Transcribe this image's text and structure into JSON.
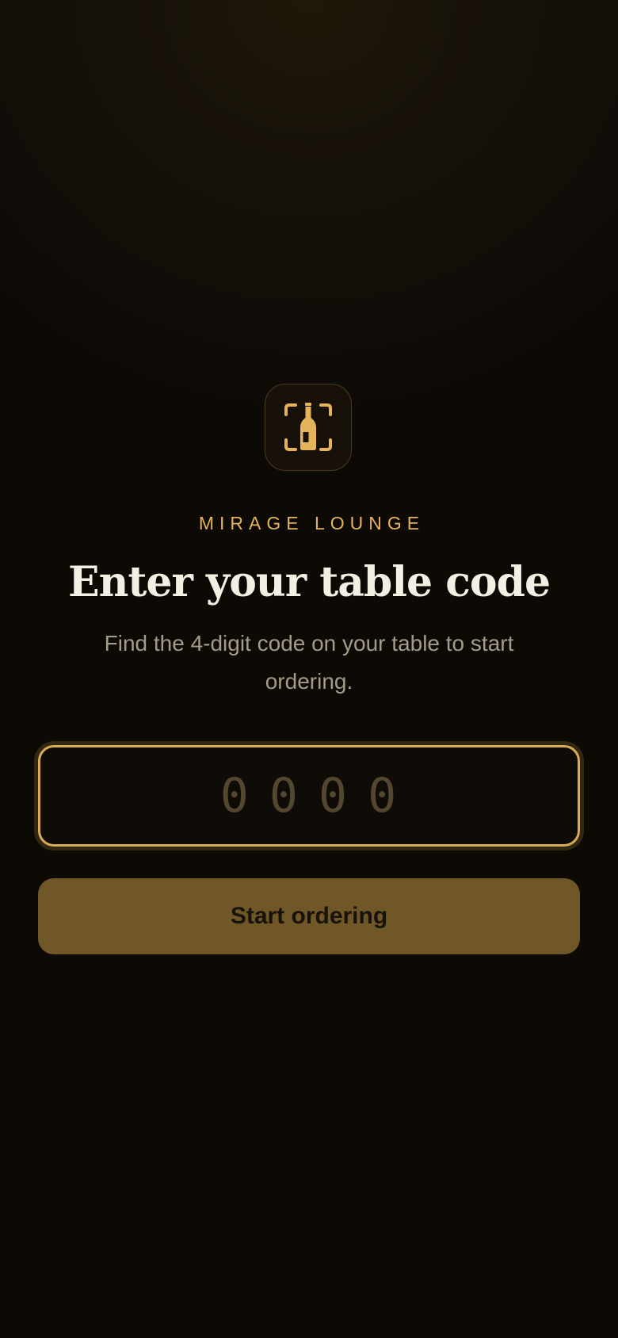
{
  "app": {
    "venue_name": "MIRAGE LOUNGE",
    "logo_icon": "bottle-scan-icon",
    "accent_color": "#e4b35a"
  },
  "main": {
    "title": "Enter your table code",
    "subtitle": "Find the 4-digit code on your table to start ordering.",
    "code_field": {
      "value": "",
      "placeholder": "0000"
    },
    "start_button_label": "Start ordering"
  }
}
